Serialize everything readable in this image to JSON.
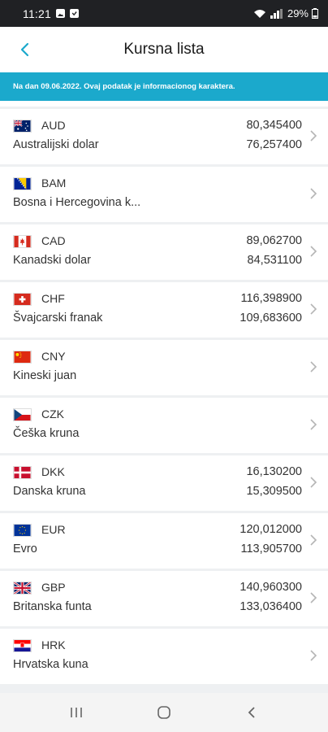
{
  "status_bar": {
    "time": "11:21",
    "battery": "29%"
  },
  "header": {
    "title": "Kursna lista"
  },
  "banner": {
    "text": "Na dan 09.06.2022. Ovaj podatak je informacionog karaktera."
  },
  "currencies": [
    {
      "code": "AUD",
      "name": "Australijski dolar",
      "buy": "80,345400",
      "sell": "76,257400",
      "flag": "australia-flag-icon"
    },
    {
      "code": "BAM",
      "name": "Bosna i Hercegovina k...",
      "buy": "",
      "sell": "",
      "flag": "bosnia-flag-icon"
    },
    {
      "code": "CAD",
      "name": "Kanadski dolar",
      "buy": "89,062700",
      "sell": "84,531100",
      "flag": "canada-flag-icon"
    },
    {
      "code": "CHF",
      "name": "Švajcarski franak",
      "buy": "116,398900",
      "sell": "109,683600",
      "flag": "switzerland-flag-icon"
    },
    {
      "code": "CNY",
      "name": "Kineski juan",
      "buy": "",
      "sell": "",
      "flag": "china-flag-icon"
    },
    {
      "code": "CZK",
      "name": "Češka kruna",
      "buy": "",
      "sell": "",
      "flag": "czech-flag-icon"
    },
    {
      "code": "DKK",
      "name": "Danska kruna",
      "buy": "16,130200",
      "sell": "15,309500",
      "flag": "denmark-flag-icon"
    },
    {
      "code": "EUR",
      "name": "Evro",
      "buy": "120,012000",
      "sell": "113,905700",
      "flag": "eu-flag-icon"
    },
    {
      "code": "GBP",
      "name": "Britanska funta",
      "buy": "140,960300",
      "sell": "133,036400",
      "flag": "uk-flag-icon"
    },
    {
      "code": "HRK",
      "name": "Hrvatska kuna",
      "buy": "",
      "sell": "",
      "flag": "croatia-flag-icon"
    }
  ],
  "colors": {
    "accent": "#1ba9cc",
    "back_arrow": "#1ba9cc"
  }
}
